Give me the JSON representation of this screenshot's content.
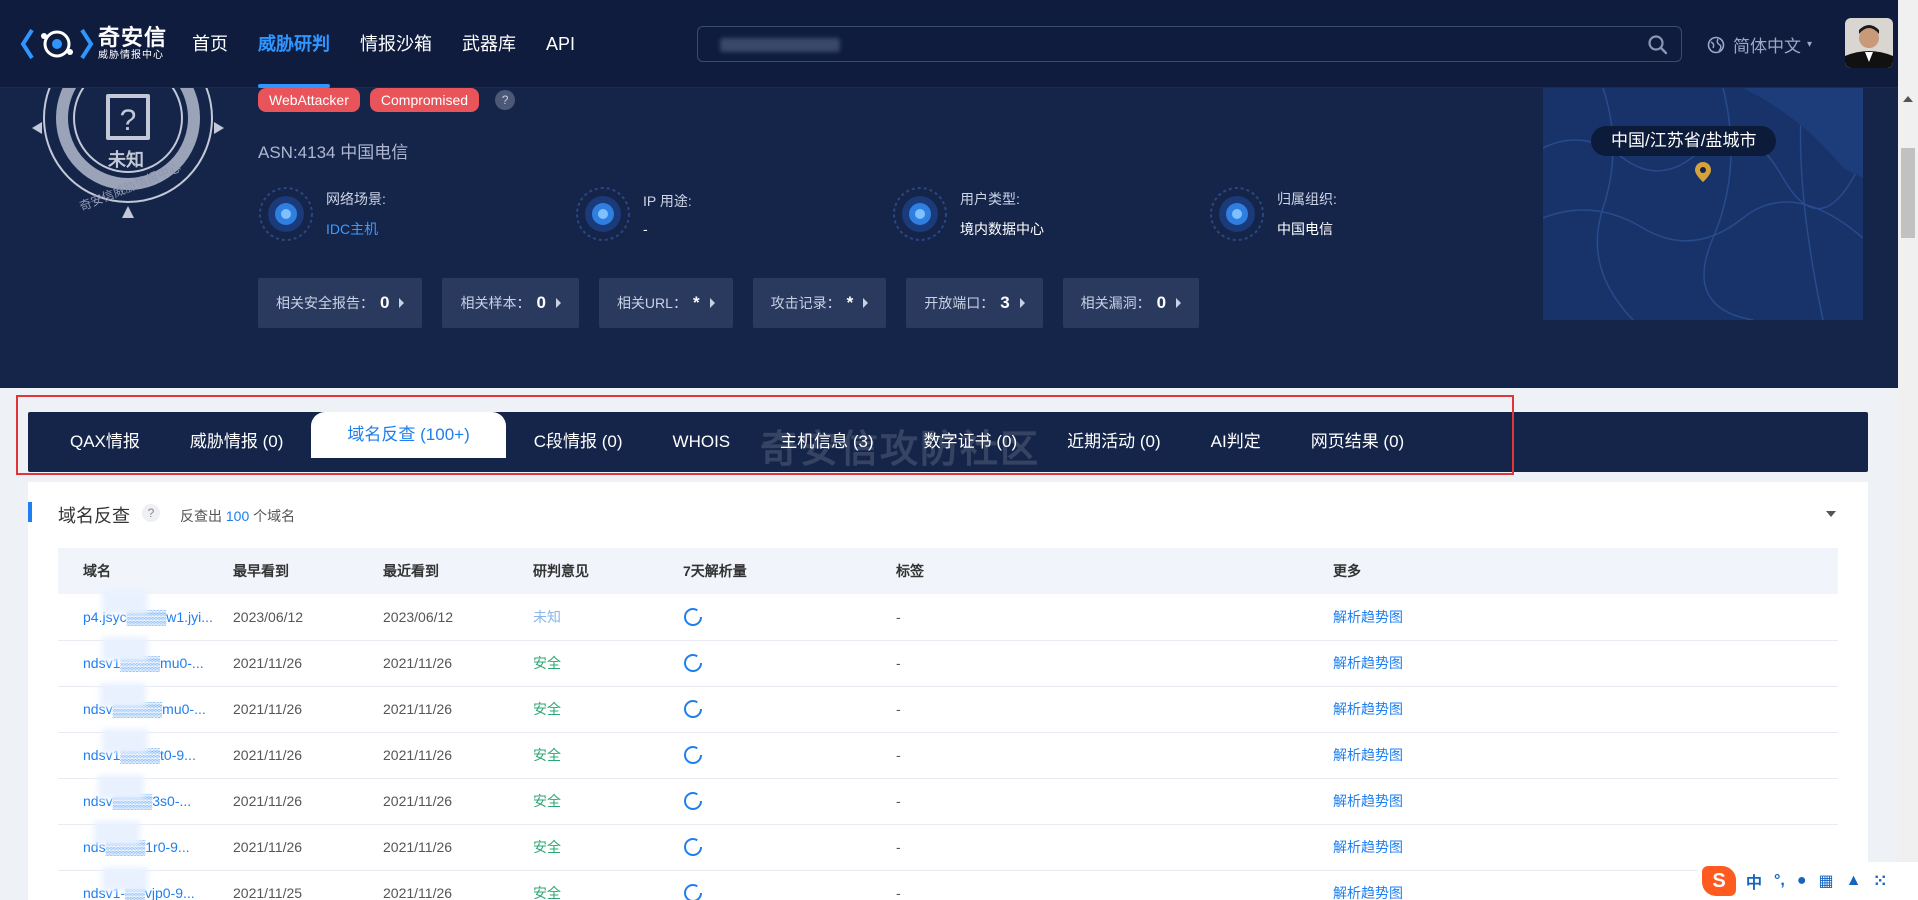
{
  "nav": {
    "logo_title": "奇安信",
    "logo_sub": "威胁情报中心",
    "items": [
      {
        "label": "首页",
        "active": false
      },
      {
        "label": "威胁研判",
        "active": true
      },
      {
        "label": "情报沙箱",
        "active": false
      },
      {
        "label": "武器库",
        "active": false
      },
      {
        "label": "API",
        "active": false
      }
    ],
    "language": "简体中文"
  },
  "hero": {
    "emblem_status": "未知",
    "emblem_ring_text": "奇安信威胁情报中心",
    "tags": [
      "WebAttacker",
      "Compromised"
    ],
    "tag_help": "?",
    "asn": "ASN:4134 中国电信",
    "attributes": [
      {
        "label": "网络场景:",
        "value": "IDC主机",
        "icon": "network-scene-icon",
        "link": true
      },
      {
        "label": "IP 用途:",
        "value": "-",
        "icon": "ip-usage-icon",
        "link": false
      },
      {
        "label": "用户类型:",
        "value": "境内数据中心",
        "icon": "user-type-icon",
        "link": false
      },
      {
        "label": "归属组织:",
        "value": "中国电信",
        "icon": "organization-icon",
        "link": false
      }
    ],
    "stats": [
      {
        "label": "相关安全报告：",
        "value": "0"
      },
      {
        "label": "相关样本：",
        "value": "0"
      },
      {
        "label": "相关URL：",
        "value": "*"
      },
      {
        "label": "攻击记录：",
        "value": "*"
      },
      {
        "label": "开放端口：",
        "value": "3"
      },
      {
        "label": "相关漏洞：",
        "value": "0"
      }
    ],
    "location": "中国/江苏省/盐城市"
  },
  "tabs": [
    {
      "label": "QAX情报",
      "active": false
    },
    {
      "label": "威胁情报 (0)",
      "active": false
    },
    {
      "label": "域名反查 (100+)",
      "active": true
    },
    {
      "label": "C段情报 (0)",
      "active": false
    },
    {
      "label": "WHOIS",
      "active": false
    },
    {
      "label": "主机信息 (3)",
      "active": false
    },
    {
      "label": "数字证书 (0)",
      "active": false
    },
    {
      "label": "近期活动 (0)",
      "active": false
    },
    {
      "label": "AI判定",
      "active": false
    },
    {
      "label": "网页结果 (0)",
      "active": false
    }
  ],
  "watermark": "奇安信攻防社区",
  "panel": {
    "title": "域名反查",
    "help": "?",
    "sub_prefix": "反查出",
    "sub_count": "100",
    "sub_suffix": "个域名",
    "columns": [
      "域名",
      "最早看到",
      "最近看到",
      "研判意见",
      "7天解析量",
      "标签",
      "更多"
    ],
    "rows": [
      {
        "domain": "p4.jsyc▒▒▒▒w1.jyi...",
        "first": "2023/06/12",
        "last": "2023/06/12",
        "verdict": "未知",
        "verdict_type": "unknown",
        "tag": "-",
        "more": "解析趋势图"
      },
      {
        "domain": "ndsv1▒▒▒▒mu0-...",
        "first": "2021/11/26",
        "last": "2021/11/26",
        "verdict": "安全",
        "verdict_type": "safe",
        "tag": "-",
        "more": "解析趋势图"
      },
      {
        "domain": "ndsv▒▒▒▒▒mu0-...",
        "first": "2021/11/26",
        "last": "2021/11/26",
        "verdict": "安全",
        "verdict_type": "safe",
        "tag": "-",
        "more": "解析趋势图"
      },
      {
        "domain": "ndsv1▒▒▒▒t0-9...",
        "first": "2021/11/26",
        "last": "2021/11/26",
        "verdict": "安全",
        "verdict_type": "safe",
        "tag": "-",
        "more": "解析趋势图"
      },
      {
        "domain": "ndsv▒▒▒▒3s0-...",
        "first": "2021/11/26",
        "last": "2021/11/26",
        "verdict": "安全",
        "verdict_type": "safe",
        "tag": "-",
        "more": "解析趋势图"
      },
      {
        "domain": "nds▒▒▒▒1r0-9...",
        "first": "2021/11/26",
        "last": "2021/11/26",
        "verdict": "安全",
        "verdict_type": "safe",
        "tag": "-",
        "more": "解析趋势图"
      },
      {
        "domain": "ndsv1-▒▒vjp0-9...",
        "first": "2021/11/25",
        "last": "2021/11/26",
        "verdict": "安全",
        "verdict_type": "safe",
        "tag": "-",
        "more": "解析趋势图"
      }
    ]
  },
  "ime": {
    "logo": "S",
    "mode": "中",
    "punct": "°,"
  },
  "colors": {
    "nav_bg": "#0f1c3e",
    "hero_bg": "#15254a",
    "accent": "#1e7ff0",
    "danger_tag": "#e8545a",
    "safe": "#2aa873",
    "highlight_box": "#e0363b"
  }
}
